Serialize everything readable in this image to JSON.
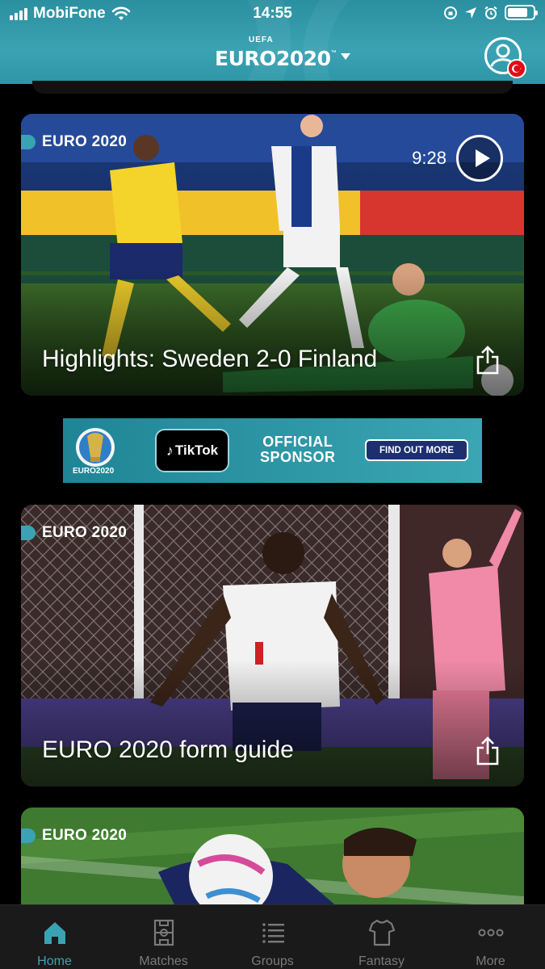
{
  "status_bar": {
    "carrier": "MobiFone",
    "time": "14:55",
    "battery_level": 0.8
  },
  "header": {
    "logo_uefa": "UEFA",
    "logo_text": "EURO2020",
    "logo_tm": "™",
    "flag_color": "#e30a17",
    "accent_color": "#3aa3b3"
  },
  "cards": [
    {
      "tag": "EURO 2020",
      "title": "Highlights: Sweden 2-0 Finland",
      "duration": "9:28",
      "has_video": true
    },
    {
      "tag": "EURO 2020",
      "title": "EURO 2020 form guide"
    },
    {
      "tag": "EURO 2020"
    }
  ],
  "ad": {
    "logo_text": "EURO2020",
    "brand": "TikTok",
    "line1": "OFFICIAL",
    "line2": "SPONSOR",
    "button": "FIND OUT MORE"
  },
  "tabbar": {
    "items": [
      {
        "label": "Home",
        "icon": "home-icon",
        "active": true
      },
      {
        "label": "Matches",
        "icon": "pitch-icon",
        "active": false
      },
      {
        "label": "Groups",
        "icon": "list-icon",
        "active": false
      },
      {
        "label": "Fantasy",
        "icon": "jersey-icon",
        "active": false
      },
      {
        "label": "More",
        "icon": "more-icon",
        "active": false
      }
    ]
  }
}
